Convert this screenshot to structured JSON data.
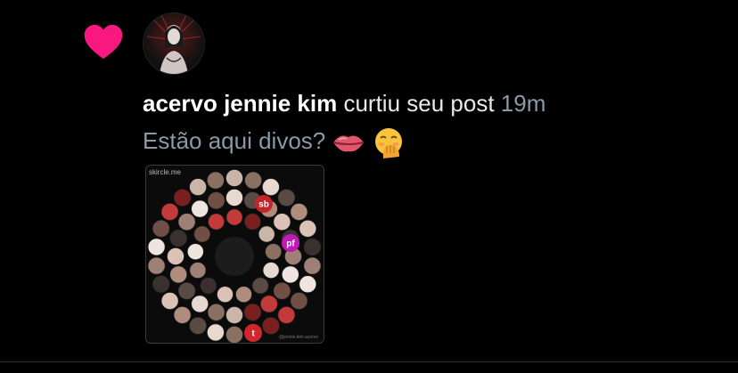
{
  "notification": {
    "type_icon": "heart-icon",
    "heart_color": "#f91880",
    "user_name": "acervo jennie kim",
    "action_text": "curtiu seu post",
    "time_ago": "19m",
    "post_text": "Estão aqui divos?",
    "emojis": [
      "lips-emoji",
      "hand-over-mouth-emoji"
    ],
    "thumbnail": {
      "label": "skircle.me",
      "footer": "@jennie.kim.acervo",
      "badges": [
        "sb",
        "pf",
        "t"
      ]
    }
  },
  "colors": {
    "background": "#000000",
    "text_primary": "#e7e9ea",
    "text_secondary": "#8b98a5"
  }
}
